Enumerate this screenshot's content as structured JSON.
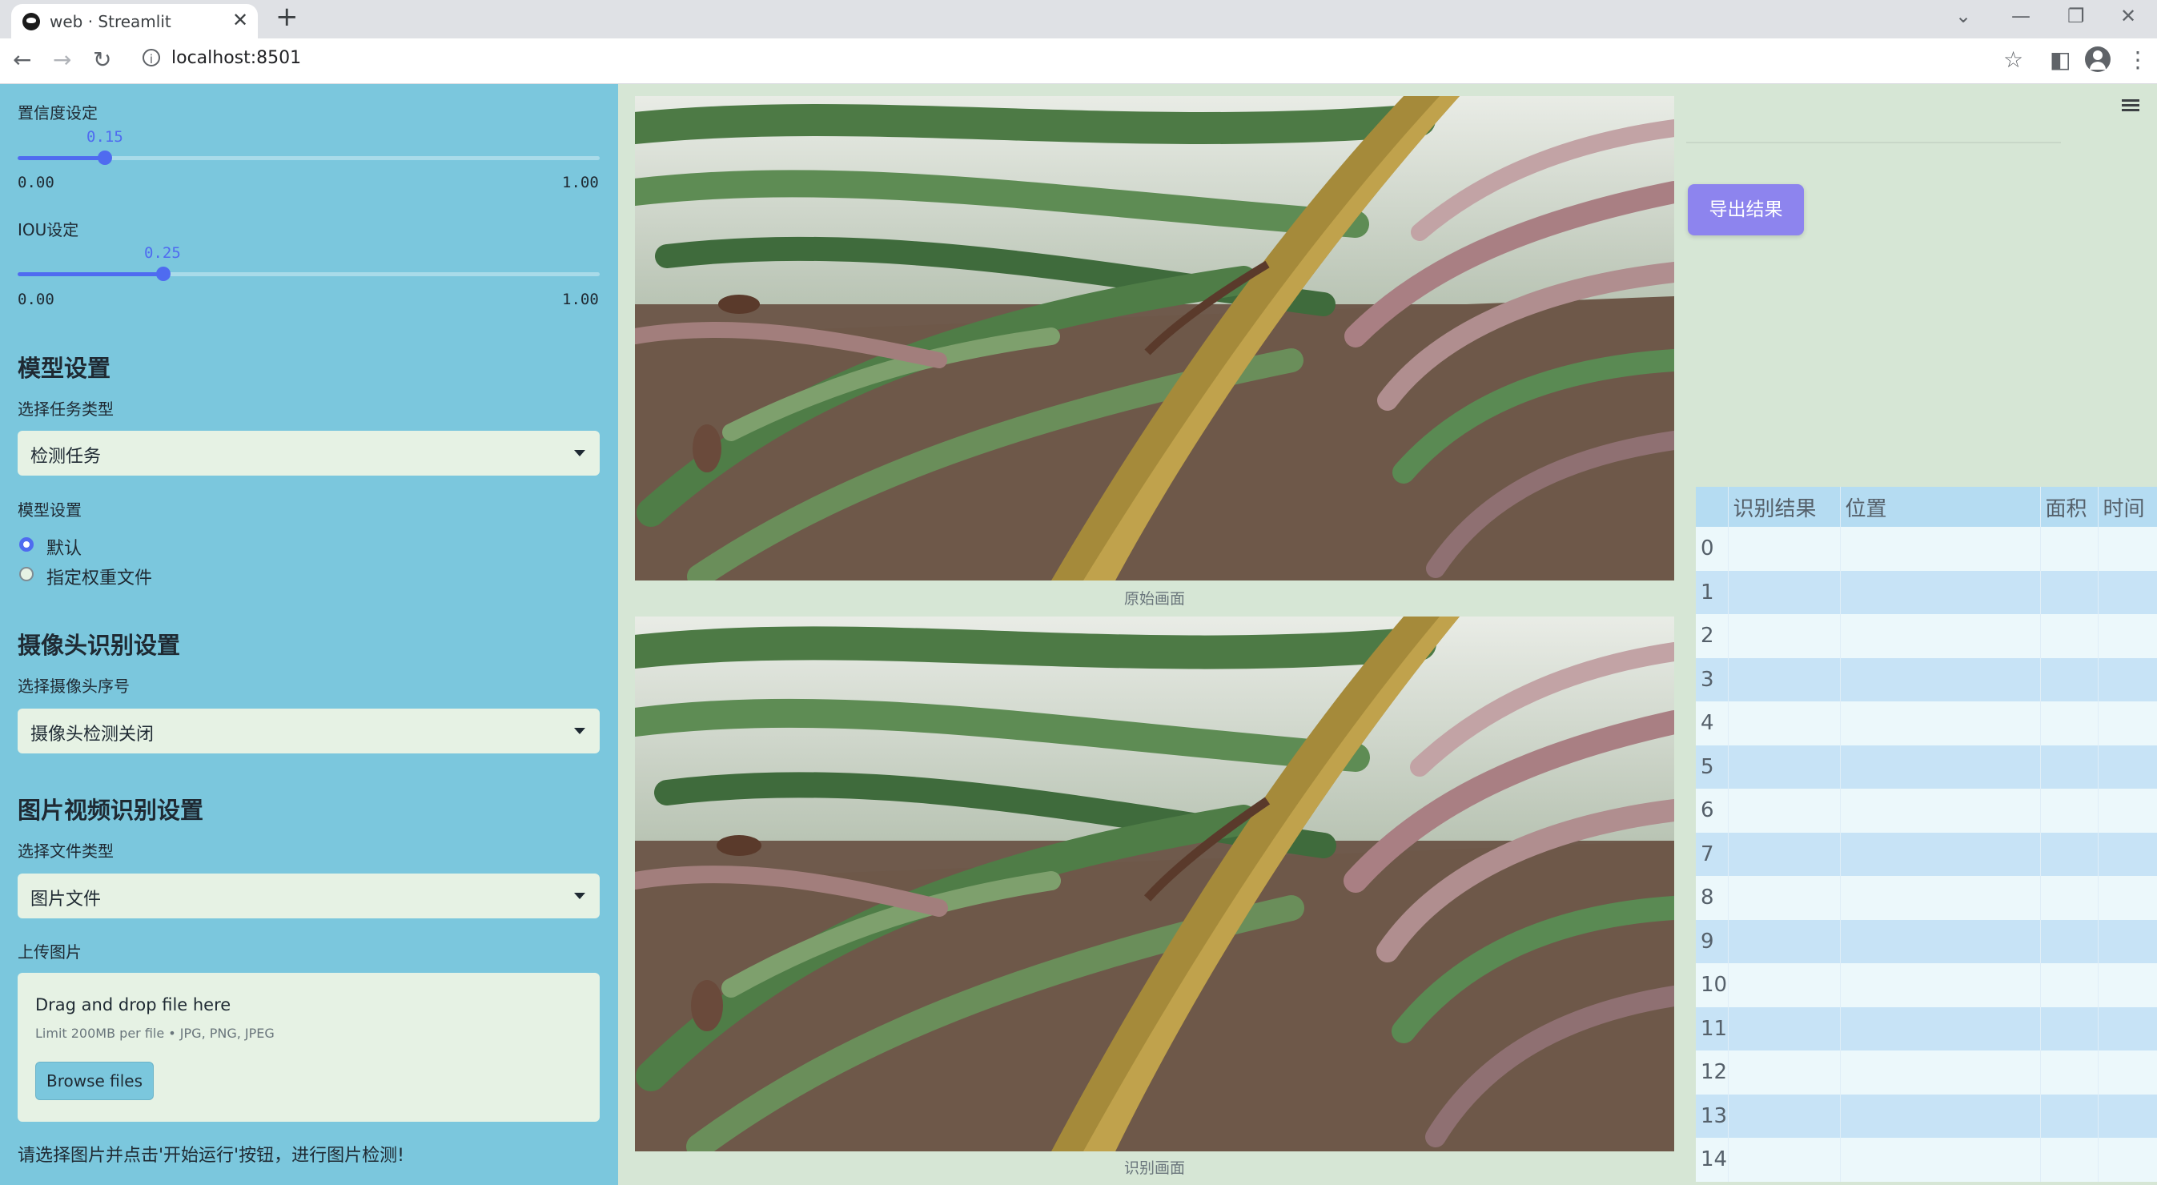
{
  "browser": {
    "tab_title": "web · Streamlit",
    "url": "localhost:8501"
  },
  "sidebar": {
    "confidence": {
      "label": "置信度设定",
      "value": 0.15,
      "value_text": "0.15",
      "min": "0.00",
      "max": "1.00"
    },
    "iou": {
      "label": "IOU设定",
      "value": 0.25,
      "value_text": "0.25",
      "min": "0.00",
      "max": "1.00"
    },
    "model_section": {
      "heading": "模型设置",
      "task_label": "选择任务类型",
      "task_value": "检测任务",
      "model_label": "模型设置",
      "options": [
        {
          "label": "默认",
          "selected": true
        },
        {
          "label": "指定权重文件",
          "selected": false
        }
      ]
    },
    "camera_section": {
      "heading": "摄像头识别设置",
      "label": "选择摄像头序号",
      "value": "摄像头检测关闭"
    },
    "file_section": {
      "heading": "图片视频识别设置",
      "label": "选择文件类型",
      "value": "图片文件",
      "upload_label": "上传图片",
      "drop_text": "Drag and drop file here",
      "limit_text": "Limit 200MB per file • JPG, PNG, JPEG",
      "browse_label": "Browse files"
    },
    "hint": "请选择图片并点击'开始运行'按钮，进行图片检测!"
  },
  "main": {
    "original_caption": "原始画面",
    "result_caption": "识别画面"
  },
  "right_panel": {
    "export_label": "导出结果",
    "table": {
      "columns": [
        "",
        "识别结果",
        "位置",
        "面积",
        "时间"
      ],
      "rows": [
        "0",
        "1",
        "2",
        "3",
        "4",
        "5",
        "6",
        "7",
        "8",
        "9",
        "10",
        "11",
        "12",
        "13",
        "14"
      ]
    }
  },
  "colors": {
    "sidebar_bg": "#7bc7dd",
    "accent": "#4f6bf0",
    "export_button": "#8d84ee",
    "page_bg": "#d6e6d5"
  }
}
